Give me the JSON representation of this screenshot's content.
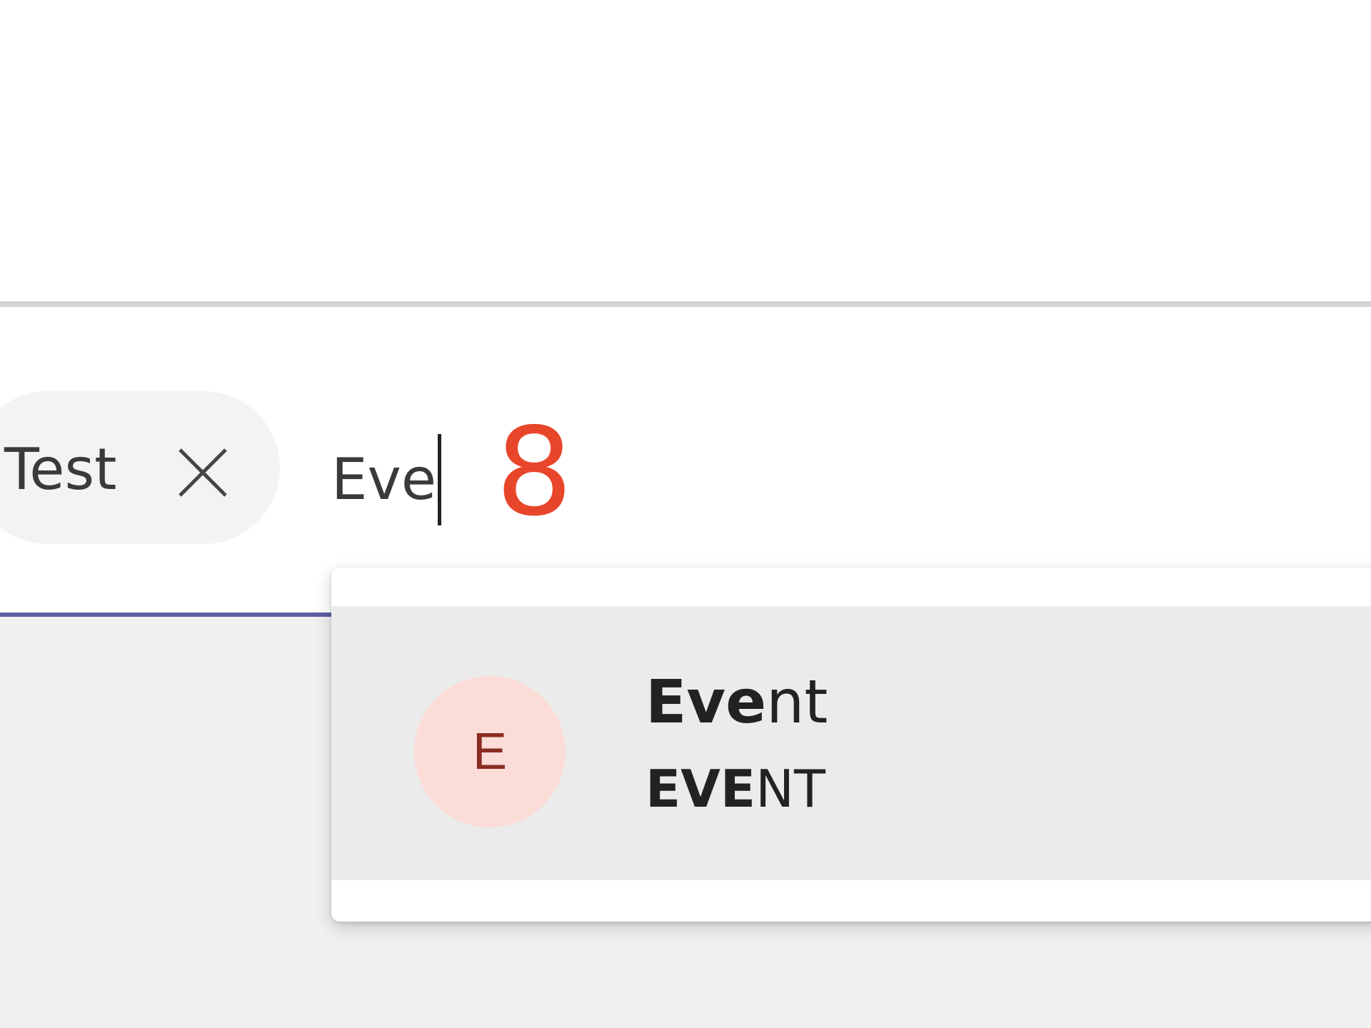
{
  "chip": {
    "label": "Test",
    "close_icon": "close-icon"
  },
  "search": {
    "value": "Eve"
  },
  "annotation": {
    "label": "8"
  },
  "suggestions": [
    {
      "avatar_initial": "E",
      "title_match": "Eve",
      "title_rest": "nt",
      "subtitle_match": "EVE",
      "subtitle_rest": "NT"
    }
  ],
  "colors": {
    "accent_underline": "#5b5fa4",
    "annotation": "#e8462a",
    "avatar_bg": "#fbdcd7",
    "avatar_text": "#8a2b22",
    "suggestion_hover_bg": "#ebebeb"
  }
}
